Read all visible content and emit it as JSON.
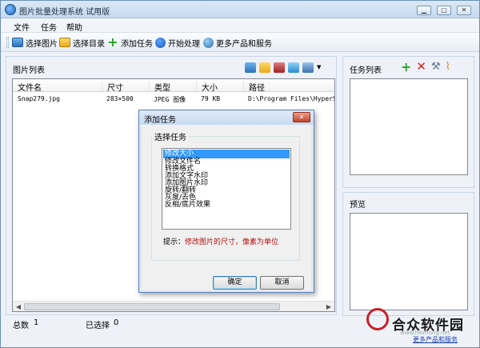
{
  "window": {
    "title": "图片批量处理系统 试用版"
  },
  "menu": {
    "file": "文件",
    "task": "任务",
    "help": "帮助"
  },
  "toolbar": {
    "select_image": "选择图片",
    "select_folder": "选择目录",
    "add_task": "添加任务",
    "start_process": "开始处理",
    "more_products": "更多产品和服务"
  },
  "image_panel": {
    "title": "图片列表",
    "columns": [
      "文件名",
      "尺寸",
      "类型",
      "大小",
      "路径"
    ],
    "rows": [
      {
        "name": "Snap279.jpg",
        "size": "283×500",
        "type": "JPEG 图像",
        "filesize": "79 KB",
        "path": "D:\\Program Files\\HyperSn"
      }
    ]
  },
  "status": {
    "total_label": "总数",
    "total_value": "1",
    "selected_label": "已选择",
    "selected_value": "0"
  },
  "task_panel": {
    "title": "任务列表"
  },
  "preview_panel": {
    "title": "预览"
  },
  "dialog": {
    "title": "添加任务",
    "group_label": "选择任务",
    "options": [
      "修改大小",
      "修改文件名",
      "转换格式",
      "添加文字水印",
      "添加图片水印",
      "旋转/翻转",
      "灰度/去色",
      "反相/底片效果"
    ],
    "selected_option": "修改大小",
    "hint_prefix": "提示：",
    "hint_text": "修改图片的尺寸，像素为单位",
    "ok": "确定",
    "cancel": "取消"
  },
  "watermark": {
    "brand": "合众软件园",
    "sub": "更多产品和服务",
    "url": "www.hezhong.net"
  },
  "icons": {
    "app": "app-icon",
    "select_image": "image-icon",
    "select_folder": "folder-icon",
    "add_task": "plus-icon",
    "start": "play-icon",
    "more": "globe-icon",
    "task_add": "plus-icon",
    "task_delete": "x-icon",
    "task_edit": "wrench-icon",
    "task_clear": "broom-icon"
  }
}
